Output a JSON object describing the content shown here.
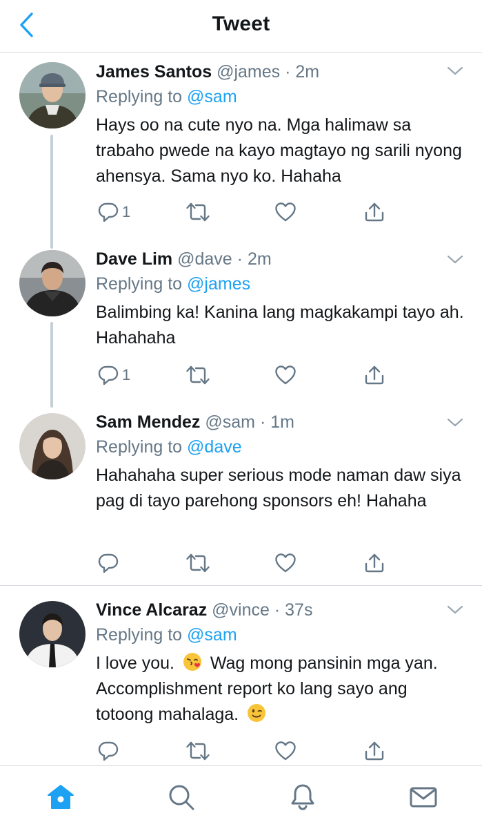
{
  "header": {
    "title": "Tweet"
  },
  "tweets": [
    {
      "name": "James Santos",
      "handle": "@james",
      "time": "· 2m",
      "replying_label": "Replying to",
      "replying_to": "@sam",
      "text": "Hays oo na cute nyo na. Mga halimaw sa trabaho pwede na kayo magtayo ng sarili nyong ahensya. Sama nyo ko. Hahaha",
      "reply_count": "1"
    },
    {
      "name": "Dave Lim",
      "handle": "@dave",
      "time": "· 2m",
      "replying_label": "Replying to",
      "replying_to": "@james",
      "text": "Balimbing ka! Kanina lang magkakampi tayo ah. Hahahaha",
      "reply_count": "1"
    },
    {
      "name": "Sam Mendez",
      "handle": "@sam",
      "time": "· 1m",
      "replying_label": "Replying to",
      "replying_to": "@dave",
      "text": "Hahahaha super serious mode naman daw siya pag di tayo parehong sponsors eh! Hahaha",
      "reply_count": ""
    },
    {
      "name": "Vince Alcaraz",
      "handle": "@vince",
      "time": "· 37s",
      "replying_label": "Replying to",
      "replying_to": "@sam",
      "text_part1": "I love you.",
      "text_part2": "Wag mong pansinin mga yan. Accomplishment report ko lang sayo ang totoong mahalaga.",
      "emoji_1": "kissing-face-with-heart-emoji",
      "emoji_2": "winking-face-emoji",
      "reply_count": ""
    }
  ],
  "icons": {
    "back": "chevron-left-icon",
    "caret": "chevron-down-icon",
    "reply": "reply-bubble-icon",
    "retweet": "retweet-icon",
    "like": "heart-icon",
    "share": "share-icon",
    "home": "home-icon",
    "search": "search-icon",
    "notifications": "bell-icon",
    "messages": "envelope-icon"
  },
  "colors": {
    "accent": "#1da1f2",
    "secondary_text": "#657786",
    "icon_gray": "#657786",
    "divider": "#d6dade",
    "thread_line": "#c4cfd6"
  }
}
